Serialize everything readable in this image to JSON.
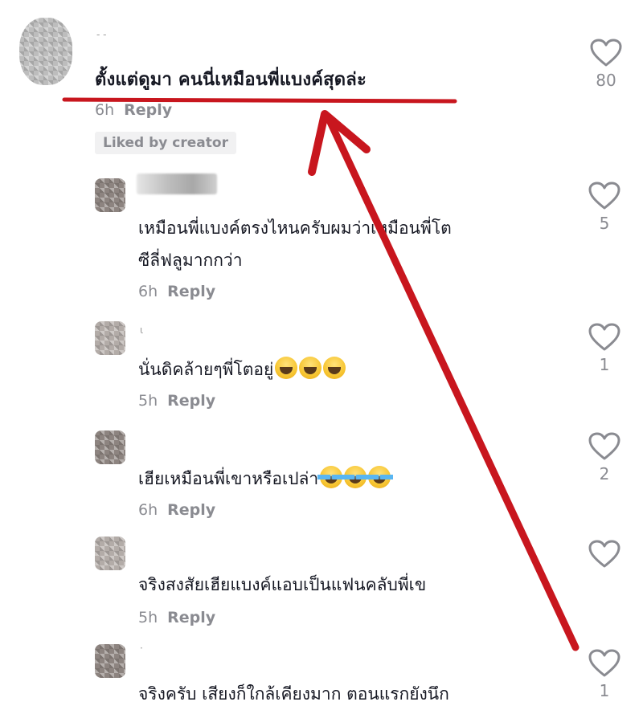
{
  "comments": [
    {
      "text": "ตั้งแต่ดูมา คนนี่เหมือนพี่แบงค์สุดล่ะ",
      "time": "6h",
      "reply": "Reply",
      "badge": "Liked by creator",
      "likes": "80"
    },
    {
      "text_line1": "เหมือนพี่แบงค์ตรงไหนครับผมว่าเหมือนพี่โต",
      "text_line2": "ซีลี่ฟลูมากกว่า",
      "time": "6h",
      "reply": "Reply",
      "likes": "5"
    },
    {
      "name_fragment": "ι",
      "text": "นั่นดิคล้ายๆพี่โตอยู่",
      "emoji": [
        "sweat-smile",
        "sweat-smile",
        "sweat-smile"
      ],
      "time": "5h",
      "reply": "Reply",
      "likes": "1"
    },
    {
      "text": "เฮียเหมือนพี่เขาหรือเปล่า",
      "emoji": [
        "tears-of-joy",
        "tears-of-joy",
        "tears-of-joy"
      ],
      "time": "6h",
      "reply": "Reply",
      "likes": "2"
    },
    {
      "text": "จริงสงสัยเฮียแบงค์แอบเป็นแฟนคลับพี่เข",
      "time": "5h",
      "reply": "Reply",
      "likes": ""
    },
    {
      "name_fragment": "·",
      "text": "จริงครับ เสียงก็ใกล้เคียงมาก ตอนแรกยังนึก",
      "likes": "1"
    }
  ],
  "icons": {
    "like": "heart-outline-icon",
    "emoji_a": "sweat-smile-emoji",
    "emoji_b": "tears-of-joy-emoji"
  },
  "colors": {
    "annotation": "#c8161e",
    "text": "#161823",
    "meta": "#8a8b91",
    "badge_bg": "#f1f1f2"
  }
}
